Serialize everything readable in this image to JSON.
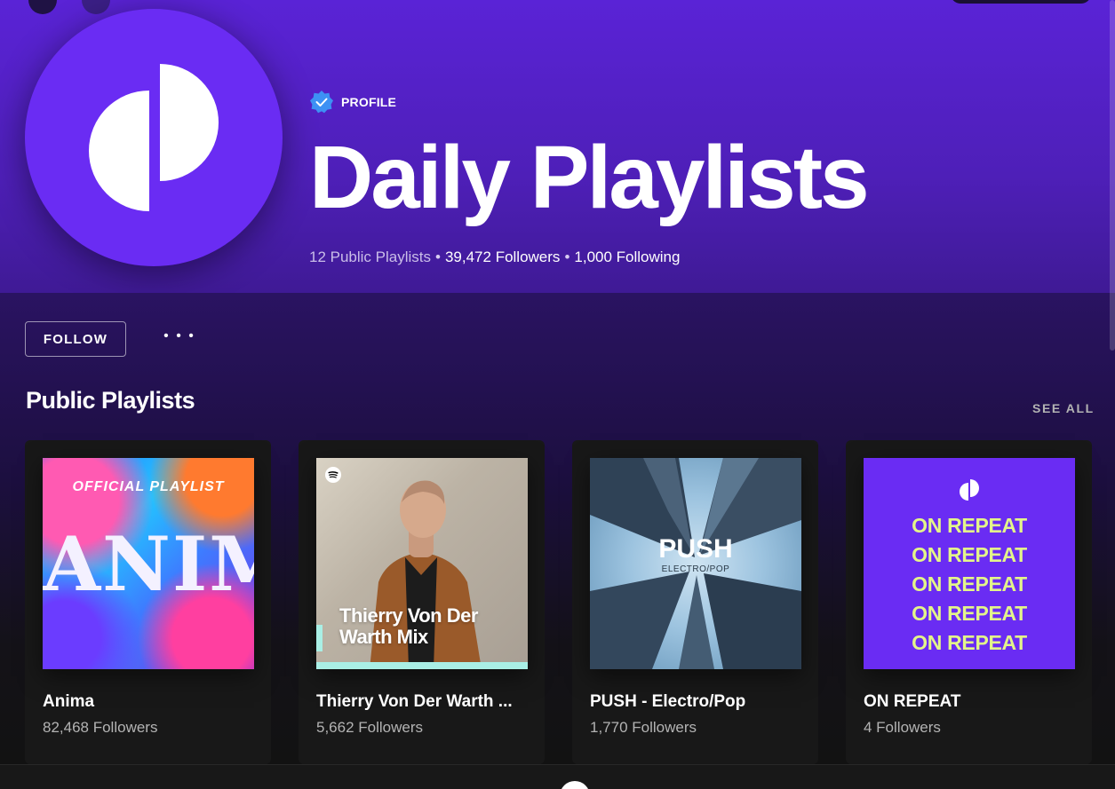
{
  "profile": {
    "type_label": "PROFILE",
    "name": "Daily Playlists",
    "public_playlists": "12 Public Playlists",
    "followers": "39,472 Followers",
    "following": "1,000 Following",
    "separator": "•",
    "avatar_color": "#6a2cf3"
  },
  "actions": {
    "follow_label": "FOLLOW",
    "more_label": "• • •"
  },
  "section": {
    "title": "Public Playlists",
    "see_all": "SEE ALL"
  },
  "playlists": [
    {
      "name": "Anima",
      "followers": "82,468 Followers",
      "cover_top": "OFFICIAL PLAYLIST",
      "cover_title": "ANIMA"
    },
    {
      "name": "Thierry Von Der Warth ...",
      "followers": "5,662 Followers",
      "cover_title_line1": "Thierry Von Der",
      "cover_title_line2": "Warth Mix"
    },
    {
      "name": "PUSH - Electro/Pop",
      "followers": "1,770 Followers",
      "cover_title": "PUSH",
      "cover_sub": "ELECTRO/POP"
    },
    {
      "name": "ON REPEAT",
      "followers": "4 Followers",
      "cover_lines": [
        "ON REPEAT",
        "ON REPEAT",
        "ON REPEAT",
        "ON REPEAT",
        "ON REPEAT"
      ]
    }
  ],
  "colors": {
    "header_purple": "#5a23d6",
    "accent_yellow": "#e3f58a",
    "verified_blue": "#3d91f4",
    "muted_text": "#b3b3b3"
  }
}
